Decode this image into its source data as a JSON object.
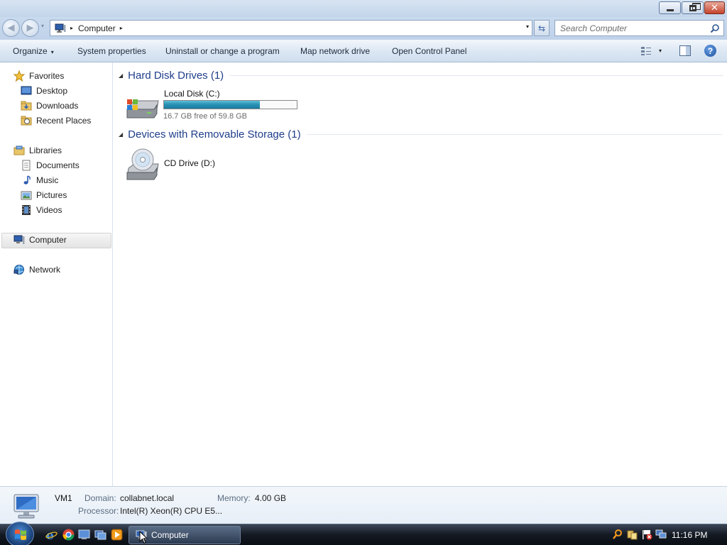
{
  "window": {
    "minimize": "–",
    "maximize": "❐",
    "close": "✕"
  },
  "nav": {
    "back": "◀",
    "forward": "▶",
    "recent": "▾",
    "refresh": "⇆"
  },
  "address": {
    "crumb": "Computer",
    "arrow": "▸",
    "dropdown": "▾"
  },
  "search": {
    "placeholder": "Search Computer"
  },
  "toolbar": {
    "organize": "Organize",
    "organize_caret": "▾",
    "system_properties": "System properties",
    "uninstall": "Uninstall or change a program",
    "map_drive": "Map network drive",
    "control_panel": "Open Control Panel",
    "views_caret": "▾",
    "help": "?"
  },
  "sidebar": {
    "favorites": "Favorites",
    "desktop": "Desktop",
    "downloads": "Downloads",
    "recent_places": "Recent Places",
    "libraries": "Libraries",
    "documents": "Documents",
    "music": "Music",
    "pictures": "Pictures",
    "videos": "Videos",
    "computer": "Computer",
    "network": "Network"
  },
  "content": {
    "hdd_group": "Hard Disk Drives (1)",
    "removable_group": "Devices with Removable Storage (1)",
    "collapse_glyph": "◢",
    "local_disk": {
      "name": "Local Disk (C:)",
      "free": "16.7 GB free of 59.8 GB",
      "used_fraction": 0.72
    },
    "cd_drive": {
      "name": "CD Drive (D:)"
    }
  },
  "details": {
    "name": "VM1",
    "domain_label": "Domain:",
    "domain_value": "collabnet.local",
    "memory_label": "Memory:",
    "memory_value": "4.00 GB",
    "processor_label": "Processor:",
    "processor_value": "Intel(R) Xeon(R) CPU E5..."
  },
  "taskbar": {
    "task_label": "Computer",
    "clock": "11:16 PM"
  }
}
